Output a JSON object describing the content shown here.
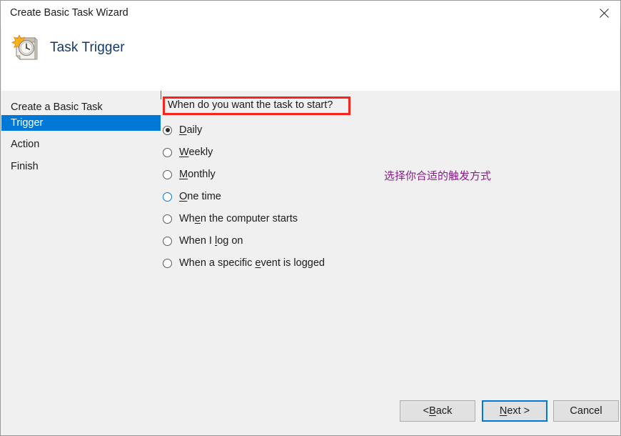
{
  "window": {
    "title": "Create Basic Task Wizard",
    "close_label": "close-icon"
  },
  "header": {
    "icon": "task-calendar-clock-icon",
    "title": "Task Trigger"
  },
  "sidebar": {
    "items": [
      {
        "label": "Create a Basic Task",
        "selected": false
      },
      {
        "label": "Trigger",
        "selected": true
      },
      {
        "label": "Action",
        "selected": false
      },
      {
        "label": "Finish",
        "selected": false
      }
    ]
  },
  "main": {
    "question": "When do you want the task to start?",
    "annotation": "选择你合适的触发方式",
    "options": [
      {
        "pre": "",
        "accel": "D",
        "post": "aily",
        "state": "checked"
      },
      {
        "pre": "",
        "accel": "W",
        "post": "eekly",
        "state": "normal"
      },
      {
        "pre": "",
        "accel": "M",
        "post": "onthly",
        "state": "normal"
      },
      {
        "pre": "",
        "accel": "O",
        "post": "ne time",
        "state": "hovered"
      },
      {
        "pre": "Wh",
        "accel": "e",
        "post": "n the computer starts",
        "state": "normal"
      },
      {
        "pre": "When I ",
        "accel": "l",
        "post": "og on",
        "state": "normal"
      },
      {
        "pre": "When a specific ",
        "accel": "e",
        "post": "vent is logged",
        "state": "normal"
      }
    ]
  },
  "footer": {
    "back": {
      "pre": "< ",
      "accel": "B",
      "post": "ack"
    },
    "next": {
      "pre": "",
      "accel": "N",
      "post": "ext >"
    },
    "cancel": {
      "pre": "Cancel",
      "accel": "",
      "post": ""
    }
  },
  "colors": {
    "accent": "#0078d7",
    "annotation_red": "#f8231b",
    "annotation_purple": "#8b1a8b",
    "header_title": "#14386b",
    "body_bg": "#f0f0f0"
  }
}
